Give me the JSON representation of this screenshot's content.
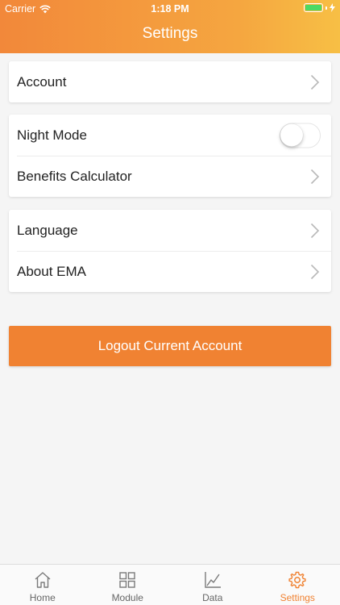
{
  "status_bar": {
    "carrier": "Carrier",
    "time": "1:18 PM"
  },
  "header": {
    "title": "Settings"
  },
  "groups": {
    "account": {
      "label": "Account"
    },
    "night_mode": {
      "label": "Night Mode",
      "enabled": false
    },
    "benefits": {
      "label": "Benefits Calculator"
    },
    "language": {
      "label": "Language"
    },
    "about": {
      "label": "About EMA"
    }
  },
  "logout": {
    "label": "Logout Current Account"
  },
  "tabbar": {
    "items": [
      {
        "label": "Home",
        "icon": "home-icon"
      },
      {
        "label": "Module",
        "icon": "grid-icon"
      },
      {
        "label": "Data",
        "icon": "chart-icon"
      },
      {
        "label": "Settings",
        "icon": "gear-icon"
      }
    ],
    "active": "Settings"
  },
  "colors": {
    "accent": "#f08232",
    "header_gradient_start": "#f2883a",
    "header_gradient_end": "#f7bf45",
    "battery": "#4cd964"
  }
}
